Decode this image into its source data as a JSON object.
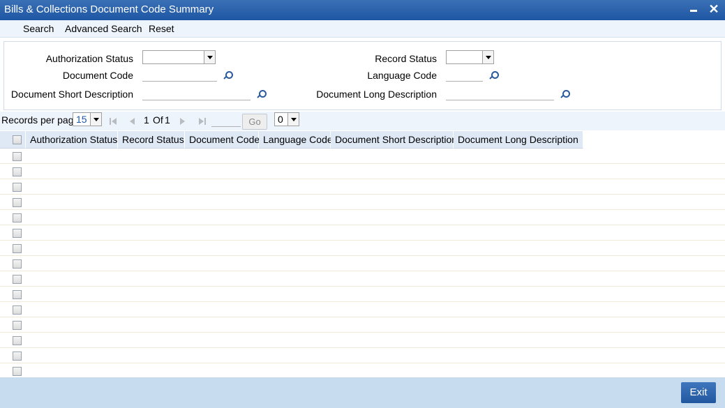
{
  "window": {
    "title": "Bills & Collections Document Code Summary",
    "minimize_icon": "minimize-icon",
    "close_label": "✕"
  },
  "toolbar": {
    "search_label": "Search",
    "advanced_search_label": "Advanced Search",
    "reset_label": "Reset"
  },
  "criteria": {
    "authorization_status_label": "Authorization Status",
    "authorization_status_value": "",
    "record_status_label": "Record Status",
    "record_status_value": "",
    "document_code_label": "Document Code",
    "document_code_value": "",
    "language_code_label": "Language Code",
    "language_code_value": "",
    "document_short_description_label": "Document Short Description",
    "document_short_description_value": "",
    "document_long_description_label": "Document Long Description",
    "document_long_description_value": ""
  },
  "pager": {
    "records_per_page_label": "Records per page",
    "records_per_page_value": "15",
    "current_page": "1",
    "of_label": "Of",
    "total_pages": "1",
    "page_input_value": "",
    "go_label": "Go",
    "selector_value": "0"
  },
  "grid": {
    "columns": [
      "Authorization Status",
      "Record Status",
      "Document Code",
      "Language Code",
      "Document Short Description",
      "Document Long Description"
    ],
    "row_count": 15
  },
  "footer": {
    "exit_label": "Exit"
  }
}
